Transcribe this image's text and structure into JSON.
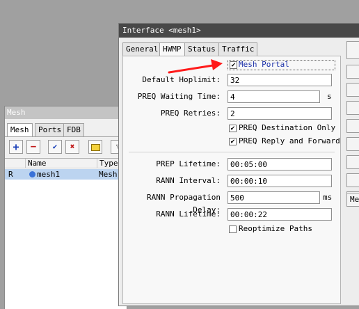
{
  "mesh_window": {
    "title": "Mesh",
    "tabs": [
      "Mesh",
      "Ports",
      "FDB"
    ],
    "toolbar": {
      "add": "+",
      "remove": "−",
      "enable": "✔",
      "disable": "✖",
      "comment": "",
      "filter": "▽"
    },
    "columns": [
      "",
      "Name",
      "Type"
    ],
    "rows": [
      {
        "flag": "R",
        "name": "mesh1",
        "type": "Mesh"
      }
    ]
  },
  "interface_window": {
    "title": "Interface <mesh1>",
    "tabs": [
      "General",
      "HWMP",
      "Status",
      "Traffic"
    ],
    "mesh_portal": {
      "label": "Mesh Portal",
      "checked": true
    },
    "fields": {
      "default_hoplimit": {
        "label": "Default Hoplimit:",
        "value": "32"
      },
      "preq_waiting_time": {
        "label": "PREQ Waiting Time:",
        "value": "4",
        "unit": "s"
      },
      "preq_retries": {
        "label": "PREQ Retries:",
        "value": "2"
      },
      "prep_lifetime": {
        "label": "PREP Lifetime:",
        "value": "00:05:00"
      },
      "rann_interval": {
        "label": "RANN Interval:",
        "value": "00:00:10"
      },
      "rann_propagation_delay": {
        "label": "RANN Propagation Delay:",
        "value": "500",
        "unit": "ms"
      },
      "rann_lifetime": {
        "label": "RANN Lifetime:",
        "value": "00:00:22"
      }
    },
    "checks": {
      "preq_destination_only": {
        "label": "PREQ Destination Only",
        "checked": true
      },
      "preq_reply_and_forward": {
        "label": "PREQ Reply and Forward",
        "checked": true
      },
      "reoptimize_paths": {
        "label": "Reoptimize Paths",
        "checked": false
      }
    },
    "side_buttons": [
      "",
      "",
      "",
      "",
      "",
      "",
      "",
      "",
      "",
      "Me"
    ],
    "check_mark": "✔"
  },
  "colors": {
    "annotation_arrow": "#ff1a1a",
    "selected_row": "#bcd4f0",
    "title_bar": "#484848"
  }
}
